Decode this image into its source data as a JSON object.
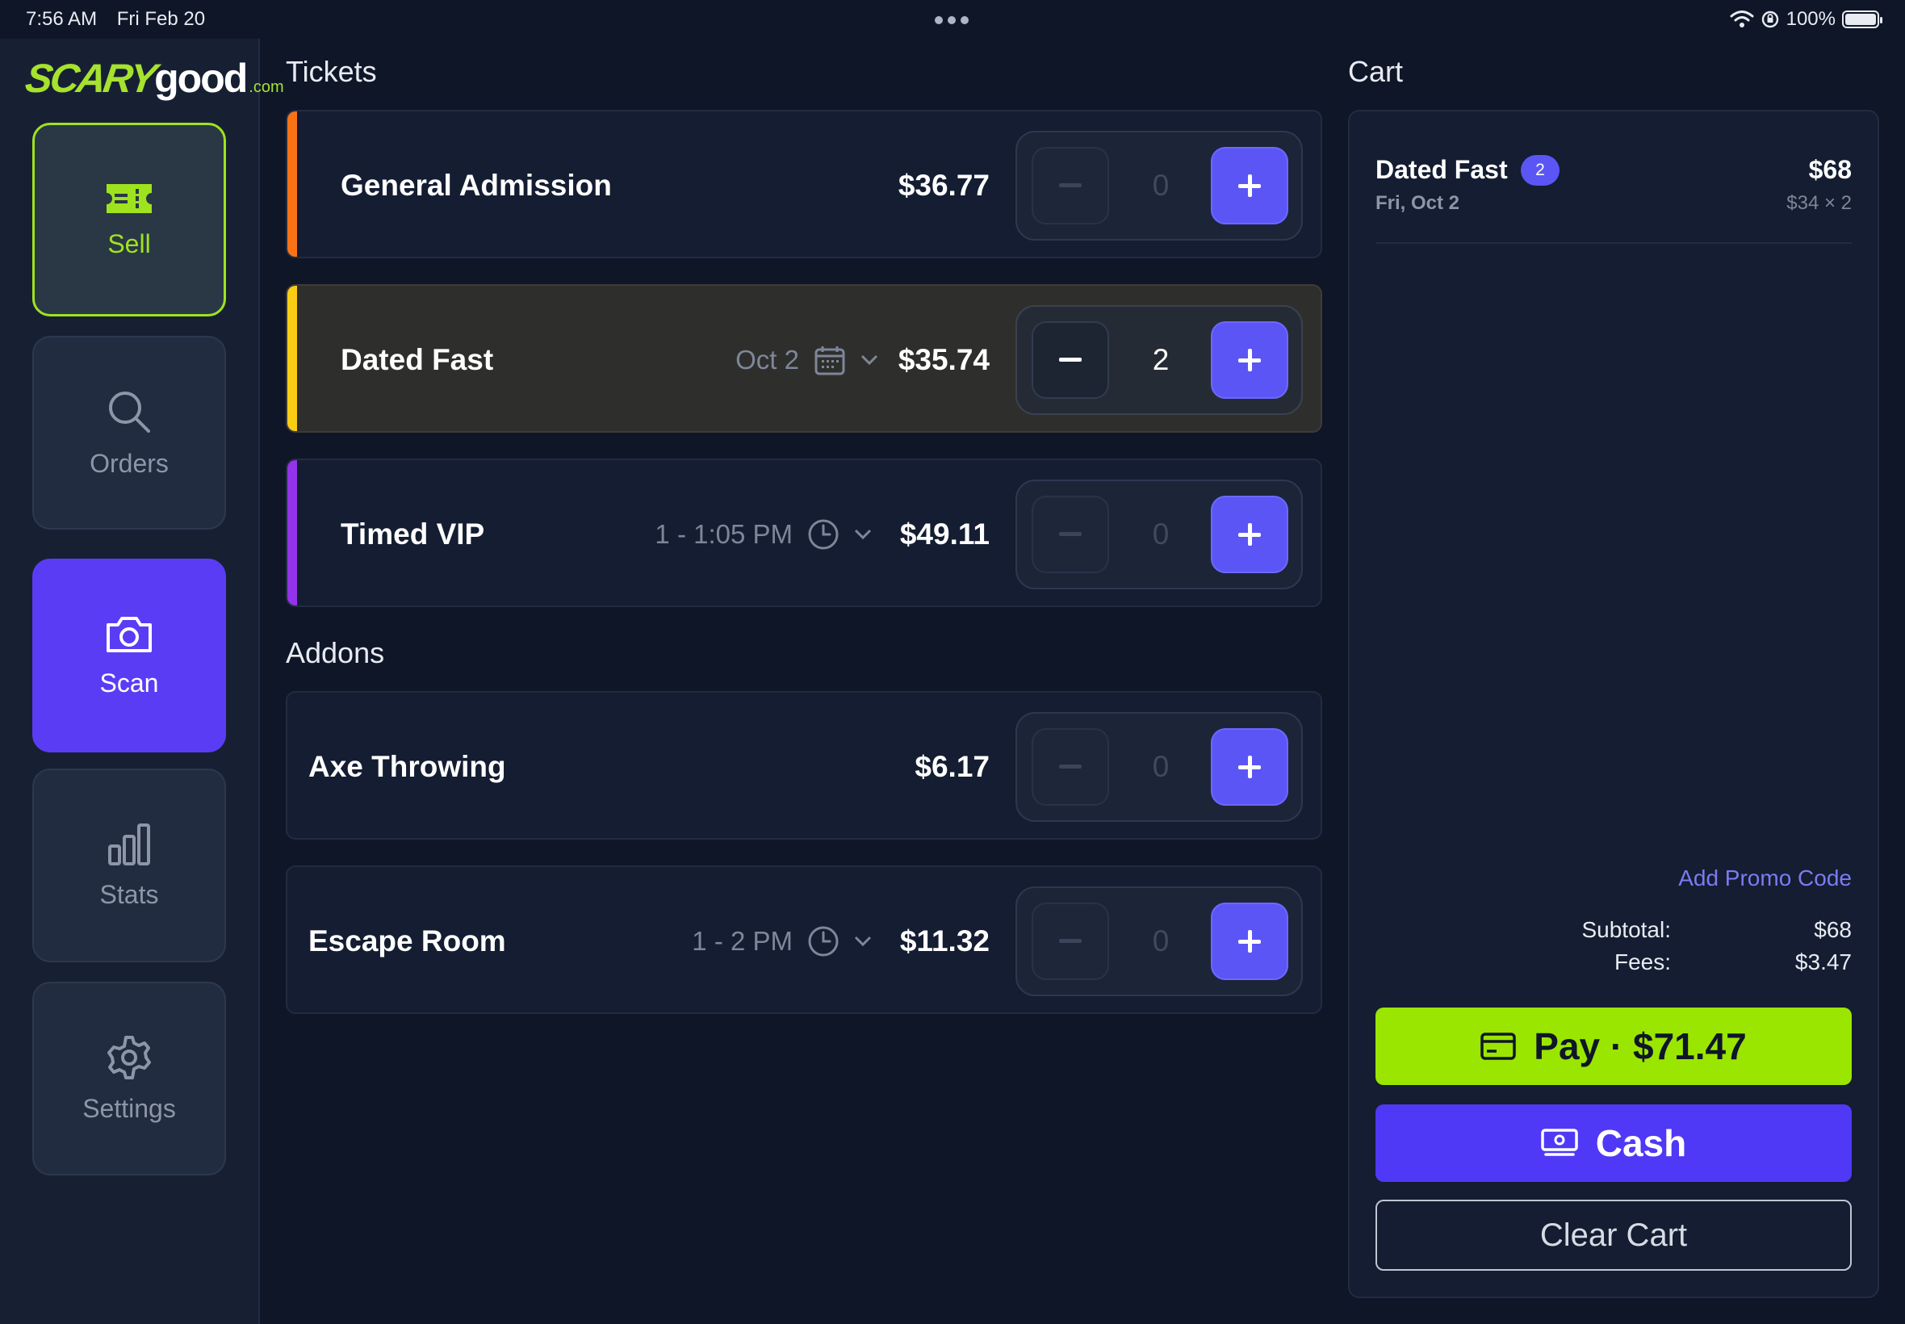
{
  "status_bar": {
    "time": "7:56 AM",
    "date": "Fri Feb 20",
    "battery": "100%"
  },
  "brand": {
    "scary": "SCARY",
    "good": "good",
    "com": ".com",
    "accent_color": "#9ee31e"
  },
  "nav": {
    "items": [
      {
        "label": "Sell",
        "icon": "ticket-icon",
        "active": true
      },
      {
        "label": "Orders",
        "icon": "search-icon"
      },
      {
        "label": "Scan",
        "icon": "camera-icon",
        "highlight": true
      },
      {
        "label": "Stats",
        "icon": "bar-chart-icon"
      },
      {
        "label": "Settings",
        "icon": "gear-icon"
      }
    ]
  },
  "tickets": {
    "title": "Tickets",
    "items": [
      {
        "name": "General Admission",
        "price": "$36.77",
        "qty": "0",
        "accent": "#f97316"
      },
      {
        "name": "Dated Fast",
        "meta": "Oct 2",
        "meta_icon": "calendar-icon",
        "price": "$35.74",
        "qty": "2",
        "accent": "#facc15",
        "selected": true
      },
      {
        "name": "Timed VIP",
        "meta": "1 - 1:05 PM",
        "meta_icon": "clock-icon",
        "price": "$49.11",
        "qty": "0",
        "accent": "#9333ea"
      }
    ]
  },
  "addons": {
    "title": "Addons",
    "items": [
      {
        "name": "Axe Throwing",
        "price": "$6.17",
        "qty": "0"
      },
      {
        "name": "Escape Room",
        "meta": "1 - 2 PM",
        "meta_icon": "clock-icon",
        "price": "$11.32",
        "qty": "0"
      }
    ]
  },
  "cart": {
    "title": "Cart",
    "items": [
      {
        "name": "Dated Fast",
        "count": "2",
        "date": "Fri, Oct 2",
        "total": "$68",
        "breakdown": "$34 × 2"
      }
    ],
    "promo": "Add Promo Code",
    "subtotal_label": "Subtotal:",
    "subtotal": "$68",
    "fees_label": "Fees:",
    "fees": "$3.47",
    "pay_label": "Pay · $71.47",
    "cash_label": "Cash",
    "clear_label": "Clear Cart"
  },
  "colors": {
    "primary": "#5b55f6",
    "pay": "#9ae600",
    "background": "#0f1628"
  }
}
